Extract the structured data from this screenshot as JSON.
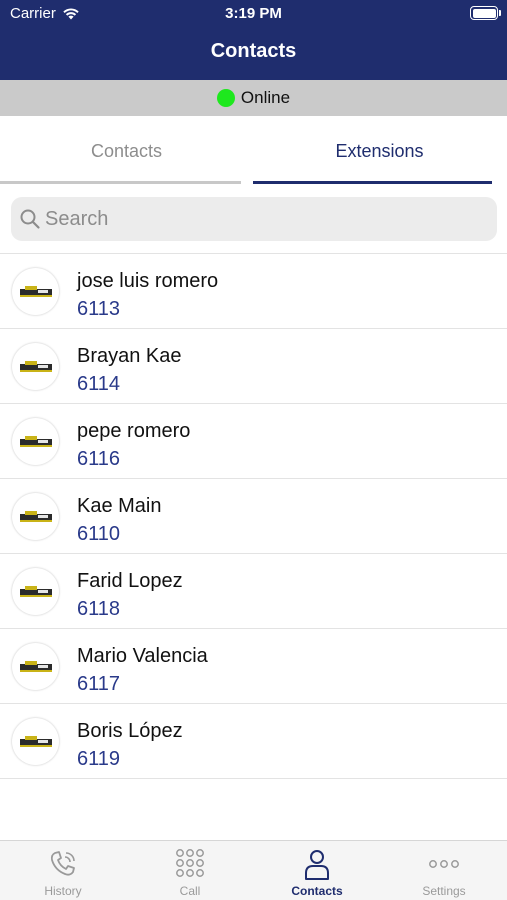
{
  "status_bar": {
    "carrier": "Carrier",
    "time": "3:19 PM"
  },
  "nav": {
    "title": "Contacts"
  },
  "connection": {
    "status_text": "Online",
    "status_color": "#1ee81e"
  },
  "segments": {
    "contacts_label": "Contacts",
    "extensions_label": "Extensions",
    "selected": "Extensions"
  },
  "search": {
    "placeholder": "Search",
    "value": ""
  },
  "contacts": [
    {
      "name": "jose luis romero",
      "extension": "6113"
    },
    {
      "name": "Brayan Kae",
      "extension": "6114"
    },
    {
      "name": "pepe romero",
      "extension": "6116"
    },
    {
      "name": "Kae Main",
      "extension": "6110"
    },
    {
      "name": "Farid Lopez",
      "extension": "6118"
    },
    {
      "name": "Mario Valencia",
      "extension": "6117"
    },
    {
      "name": "Boris López",
      "extension": "6119"
    }
  ],
  "tab_bar": {
    "items": [
      {
        "label": "History",
        "icon": "phone-history-icon"
      },
      {
        "label": "Call",
        "icon": "keypad-icon"
      },
      {
        "label": "Contacts",
        "icon": "person-icon"
      },
      {
        "label": "Settings",
        "icon": "more-icon"
      }
    ],
    "selected": "Contacts"
  },
  "colors": {
    "brand": "#1f2d6e",
    "extension_text": "#2a3a8a",
    "inactive": "#9a9a9a"
  }
}
